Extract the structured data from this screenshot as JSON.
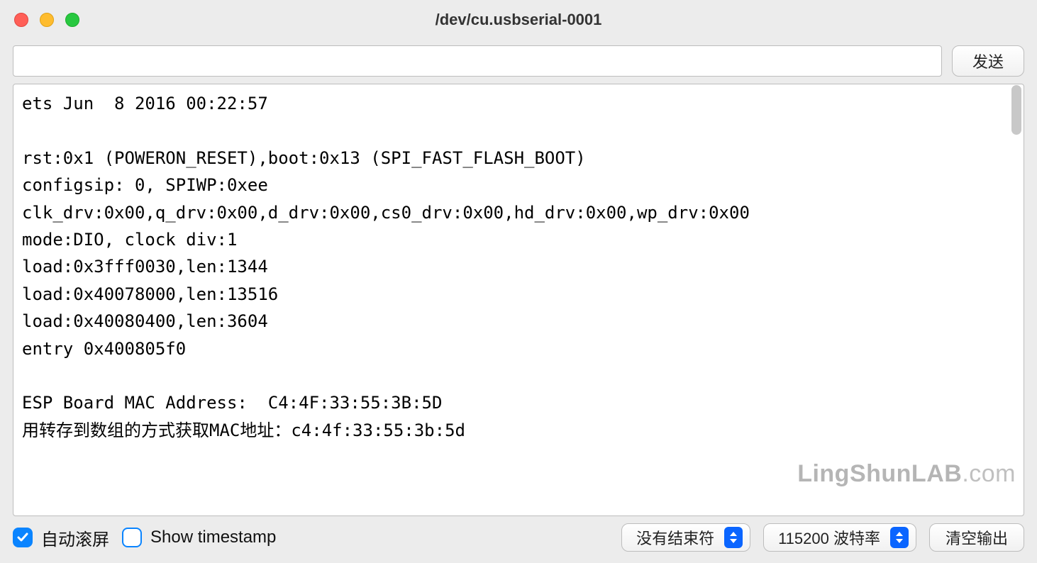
{
  "window": {
    "title": "/dev/cu.usbserial-0001"
  },
  "toolbar": {
    "input_value": "",
    "send_label": "发送"
  },
  "console": {
    "lines": "ets Jun  8 2016 00:22:57\n\nrst:0x1 (POWERON_RESET),boot:0x13 (SPI_FAST_FLASH_BOOT)\nconfigsip: 0, SPIWP:0xee\nclk_drv:0x00,q_drv:0x00,d_drv:0x00,cs0_drv:0x00,hd_drv:0x00,wp_drv:0x00\nmode:DIO, clock div:1\nload:0x3fff0030,len:1344\nload:0x40078000,len:13516\nload:0x40080400,len:3604\nentry 0x400805f0\n\nESP Board MAC Address:  C4:4F:33:55:3B:5D\n用转存到数组的方式获取MAC地址：c4:4f:33:55:3b:5d"
  },
  "watermark": {
    "main": "LingShunLAB",
    "suffix": ".com"
  },
  "footer": {
    "autoscroll_label": "自动滚屏",
    "autoscroll_checked": true,
    "timestamp_label": "Show timestamp",
    "timestamp_checked": false,
    "line_ending_selected": "没有结束符",
    "baud_selected": "115200 波特率",
    "clear_label": "清空输出"
  }
}
